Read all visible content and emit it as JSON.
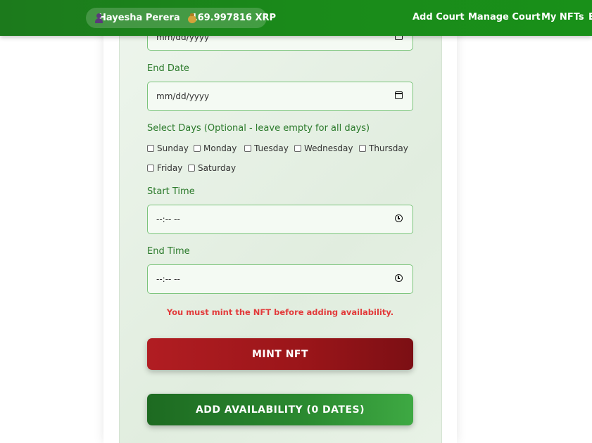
{
  "header": {
    "user_name": "Hayesha Perera",
    "balance": "169.997816 XRP",
    "nav": [
      "Add Court",
      "Manage Court",
      "My NFTs",
      "E"
    ]
  },
  "form": {
    "start_date_value": "mm/dd/yyyy",
    "end_date_label": "End Date",
    "end_date_value": "mm/dd/yyyy",
    "days_label": "Select Days (Optional - leave empty for all days)",
    "days": [
      "Sunday",
      "Monday",
      "Tuesday",
      "Wednesday",
      "Thursday",
      "Friday",
      "Saturday"
    ],
    "start_time_label": "Start Time",
    "start_time_value": "--:-- --",
    "end_time_label": "End Time",
    "end_time_value": "--:-- --",
    "error": "You must mint the NFT before adding availability.",
    "mint_button": "MINT NFT",
    "add_button": "ADD AVAILABILITY (0 DATES)"
  },
  "colors": {
    "header_green": "#1a8a1a",
    "label_green": "#2b7a2b",
    "error_red": "#e23b3b",
    "mint_red": "#a3181c",
    "add_green": "#2b8a30"
  }
}
